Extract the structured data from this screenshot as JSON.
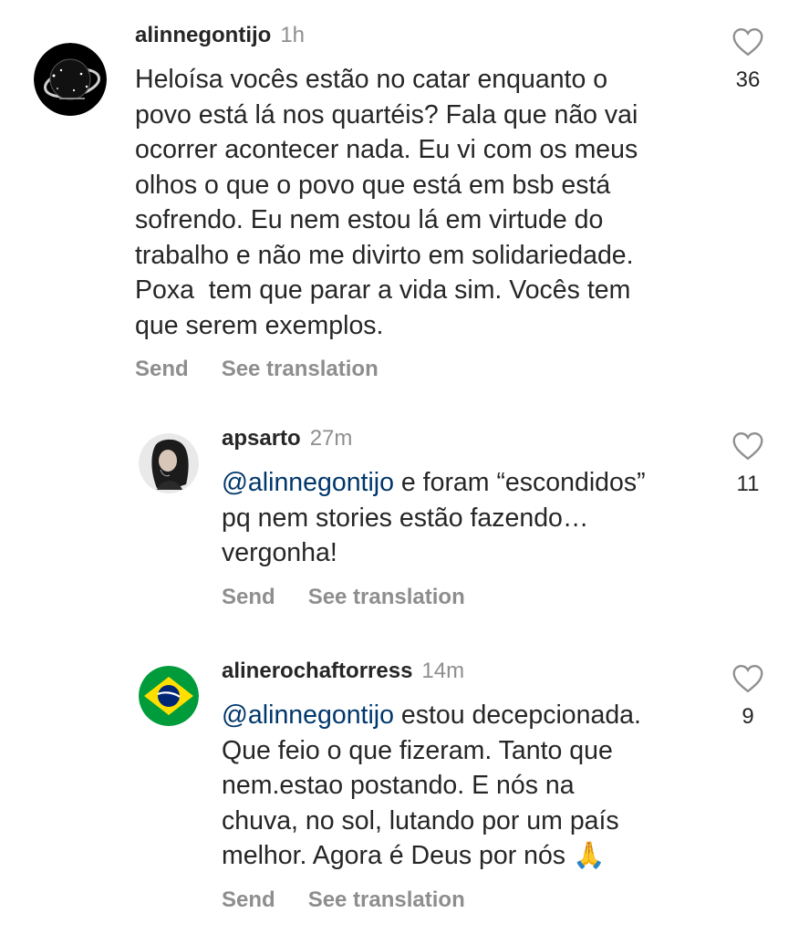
{
  "comments": [
    {
      "username": "alinnegontijo",
      "time": "1h",
      "mention": "",
      "text": "Heloísa vocês estão no catar enquanto o\npovo está lá nos quartéis? Fala que não vai\nocorrer acontecer nada. Eu vi com os meus\nolhos o que o povo que está em bsb está\nsofrendo. Eu nem estou lá em virtude do\ntrabalho e não me divirto em solidariedade.\nPoxa  tem que parar a vida sim. Vocês tem\nque serem exemplos.",
      "likes": "36",
      "send_label": "Send",
      "translate_label": "See translation",
      "avatar_icon": "night-globe-avatar"
    },
    {
      "username": "apsarto",
      "time": "27m",
      "mention": "@alinnegontijo",
      "text": " e foram “escondidos”\npq nem stories estão fazendo…\nvergonha!",
      "likes": "11",
      "send_label": "Send",
      "translate_label": "See translation",
      "avatar_icon": "woman-portrait-avatar"
    },
    {
      "username": "alinerochaftorress",
      "time": "14m",
      "mention": "@alinnegontijo",
      "text": " estou decepcionada.\nQue feio o que fizeram. Tanto que\nnem.estao postando. E nós na\nchuva, no sol, lutando por um país\nmelhor. Agora é Deus por nós 🙏",
      "likes": "9",
      "send_label": "Send",
      "translate_label": "See translation",
      "avatar_icon": "brazil-flag-avatar"
    }
  ],
  "colors": {
    "text": "#262626",
    "secondary": "#8e8e8e",
    "mention": "#00376b",
    "flag_green": "#009c3b",
    "flag_yellow": "#ffdf00",
    "flag_blue": "#002776"
  }
}
